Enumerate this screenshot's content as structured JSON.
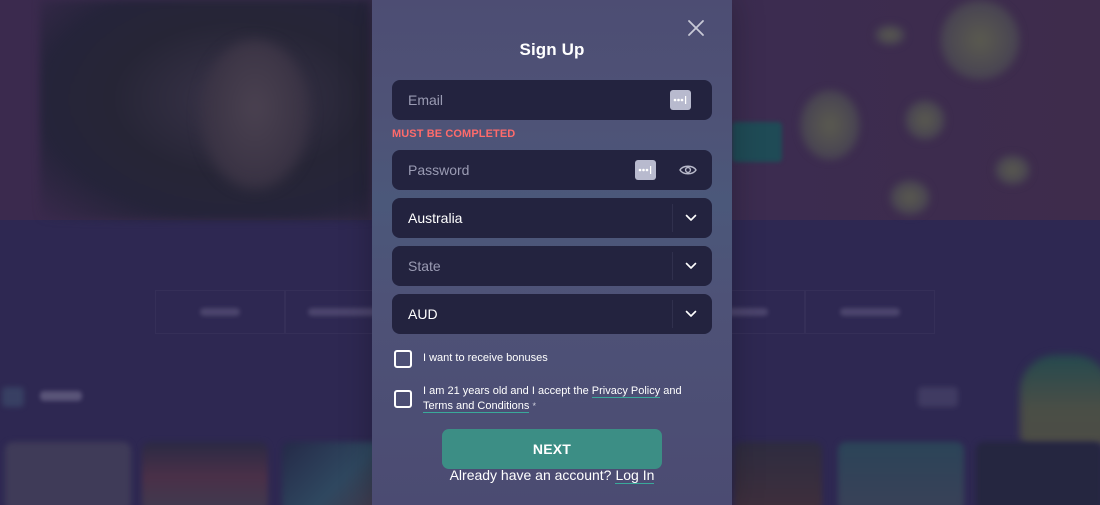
{
  "modal": {
    "title": "Sign Up",
    "close_icon": "close-icon",
    "email": {
      "placeholder": "Email",
      "value": "",
      "error": "MUST BE COMPLETED",
      "autofill_icon": "password-manager-key-icon"
    },
    "password": {
      "placeholder": "Password",
      "value": "",
      "autofill_icon": "password-manager-key-icon",
      "toggle_icon": "eye-icon"
    },
    "country": {
      "value": "Australia",
      "chevron_icon": "chevron-down-icon"
    },
    "state": {
      "placeholder": "State",
      "value": "",
      "chevron_icon": "chevron-down-icon"
    },
    "currency": {
      "value": "AUD",
      "chevron_icon": "chevron-down-icon"
    },
    "bonuses_checkbox": {
      "label": "I want to receive bonuses",
      "checked": false
    },
    "terms_checkbox": {
      "text_before": "I am 21 years old and I accept the ",
      "privacy_link": "Privacy Policy",
      "text_between": " and ",
      "terms_link": "Terms and Conditions",
      "required_mark": "*",
      "checked": false
    },
    "next_button": "NEXT",
    "login_prompt": "Already have an account?",
    "login_link": "Log In"
  },
  "colors": {
    "accent": "#3c8e85",
    "link_underline": "#3aa99a",
    "error": "#ff6b6b",
    "field_bg": "#23233f",
    "modal_bg": "#4d5277",
    "page_bg": "#2e2852"
  }
}
